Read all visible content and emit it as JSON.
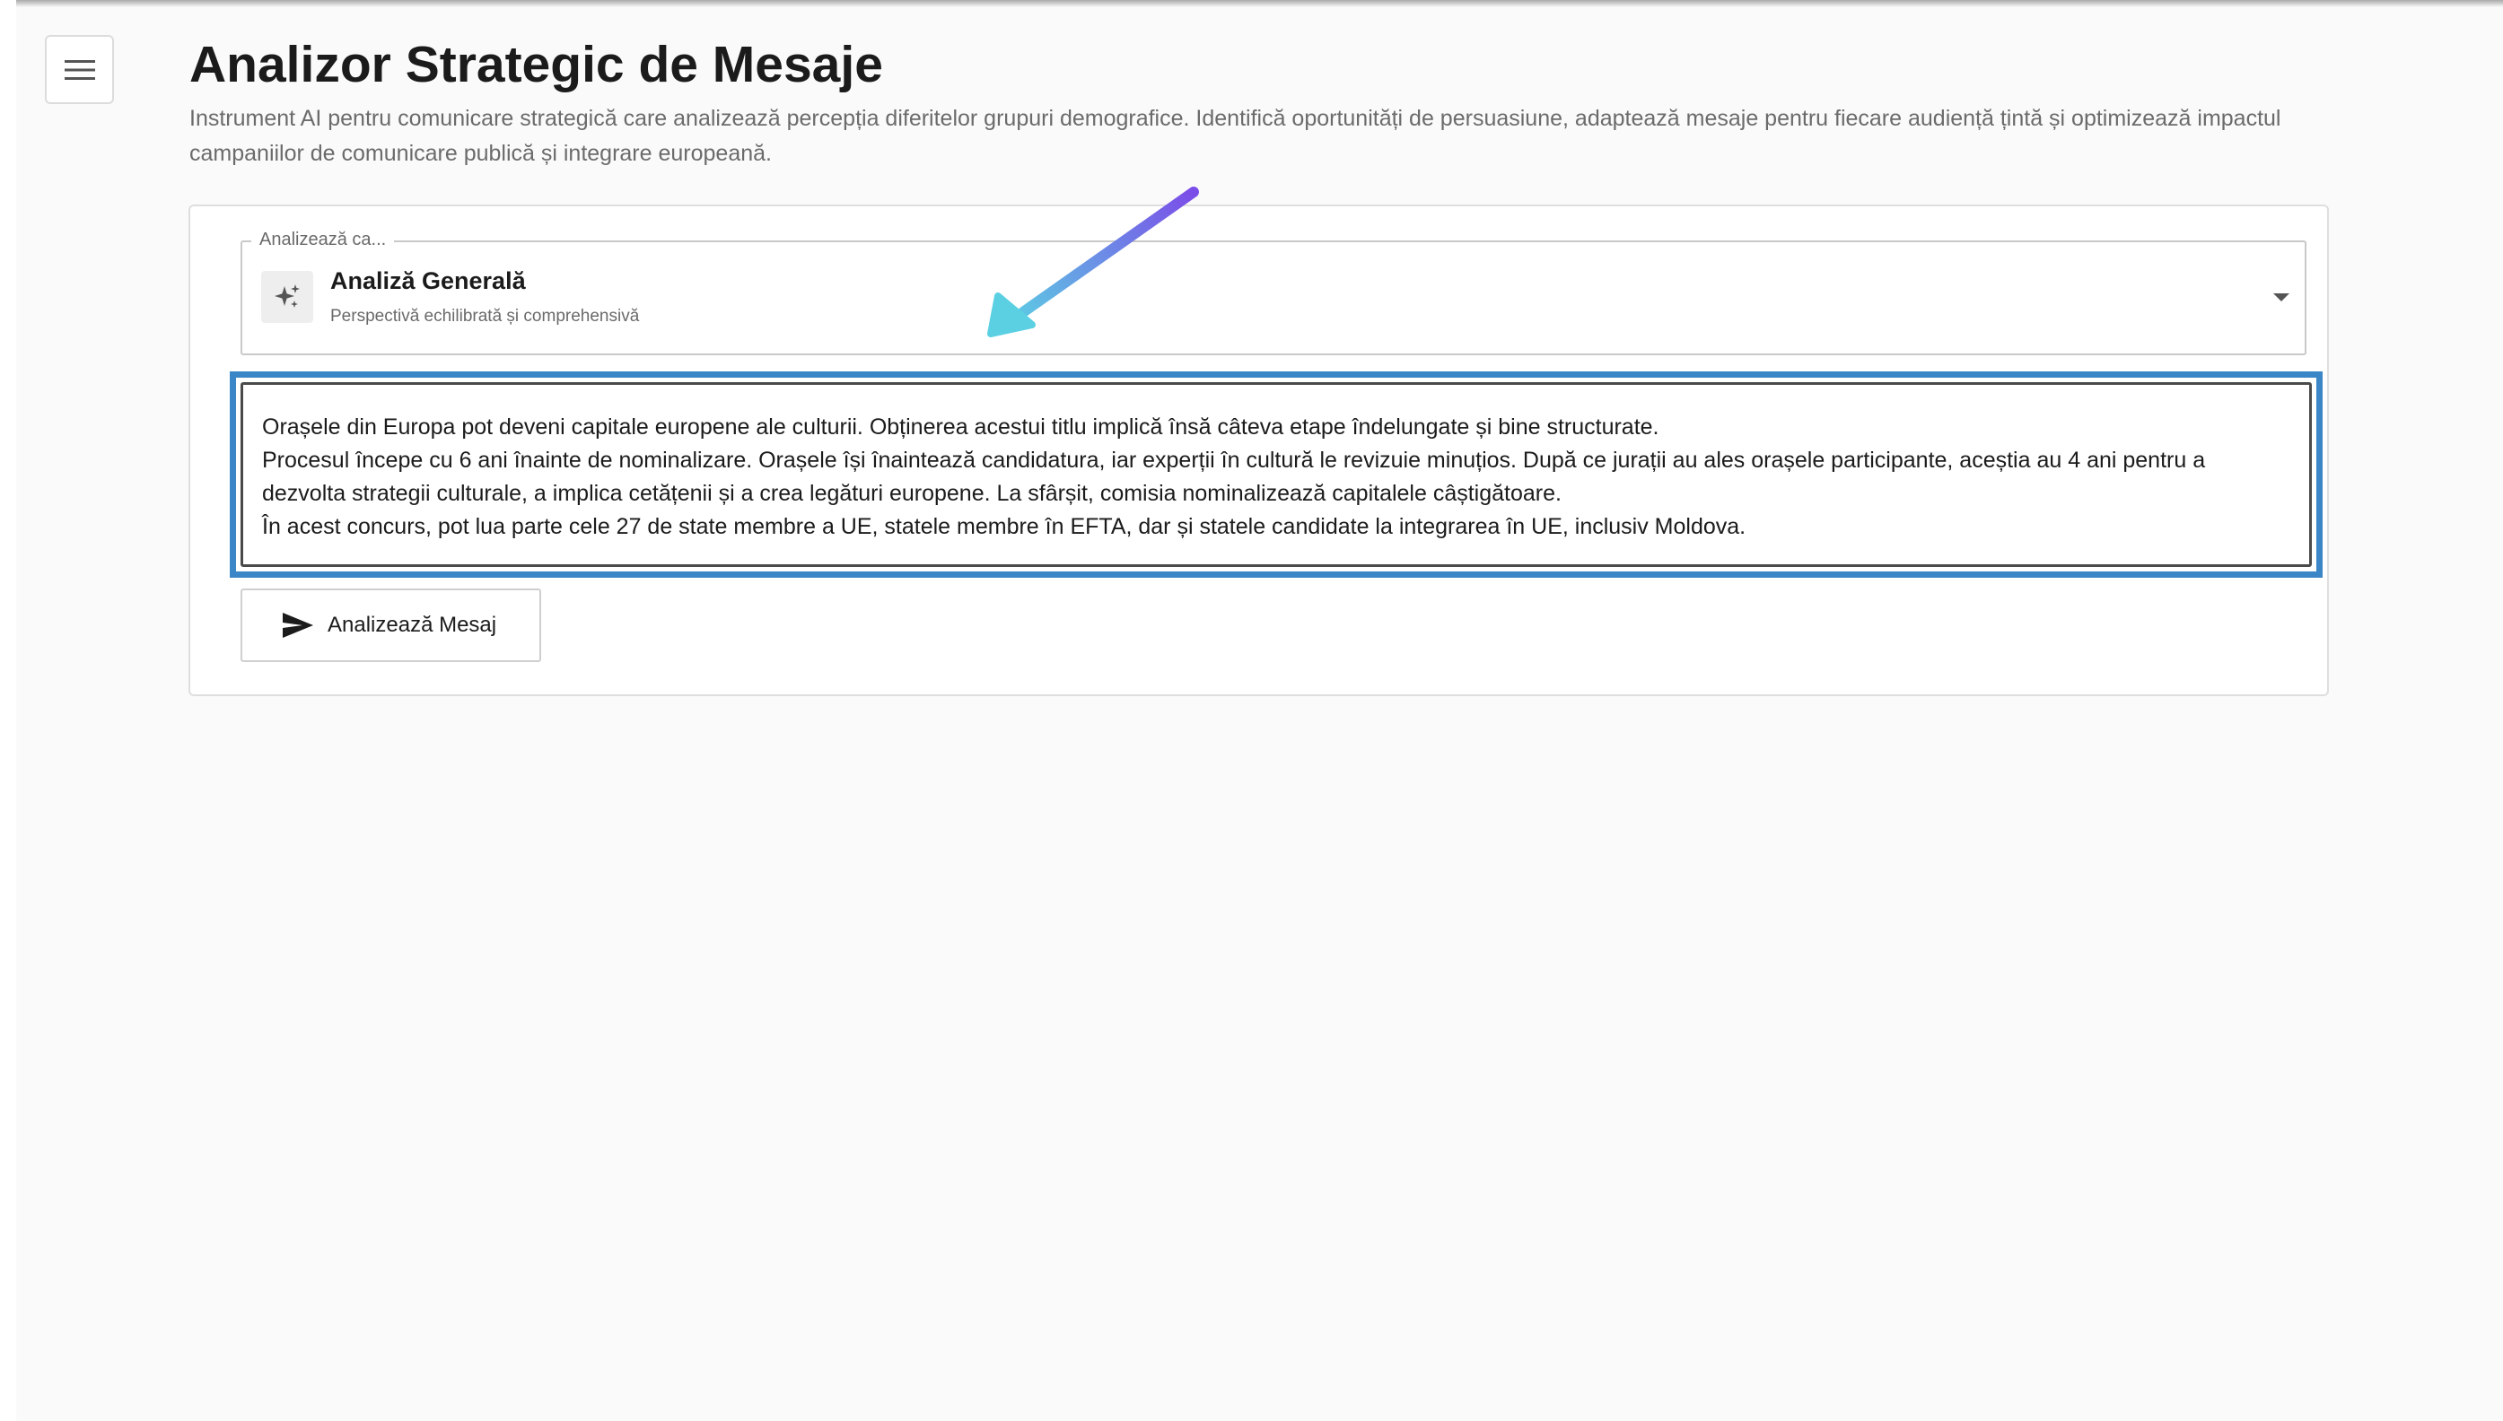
{
  "app": {
    "title": "Analizor Strategic de Mesaje",
    "description": "Instrument AI pentru comunicare strategică care analizează percepția diferitelor grupuri demografice. Identifică oportunități de persuasiune, adaptează mesaje pentru fiecare audiență țintă și optimizează impactul campaniilor de comunicare publică și integrare europeană."
  },
  "header": {
    "menu_icon": "hamburger-menu-icon"
  },
  "perspective_select": {
    "label": "Analizează ca...",
    "selected_title": "Analiză Generală",
    "selected_subtitle": "Perspectivă echilibrată și comprehensivă",
    "icon": "sparkles-icon",
    "dropdown_icon": "caret-down-icon"
  },
  "message_input": {
    "lines": [
      "Orașele din Europa pot deveni capitale europene ale culturii. Obținerea acestui titlu implică însă câteva etape îndelungate și bine structurate.",
      "Procesul începe cu 6 ani înainte de nominalizare. Orașele își înaintează candidatura, iar experții în cultură le revizuie minuțios. După ce jurații au ales orașele participante, aceștia au 4 ani pentru a dezvolta strategii culturale, a implica cetățenii și a crea legături europene. La sfârșit, comisia nominalizează capitalele câștigătoare.",
      "În acest concurs, pot lua parte cele 27 de state membre a UE, statele membre în EFTA, dar și statele candidate la integrarea în UE, inclusiv Moldova."
    ],
    "highlight_color": "#3b86c6"
  },
  "submit_button": {
    "label": "Analizează Mesaj",
    "icon": "send-icon"
  },
  "annotation": {
    "icon": "pointer-arrow",
    "gradient_start": "#5bd0e3",
    "gradient_end": "#7b4de8"
  }
}
